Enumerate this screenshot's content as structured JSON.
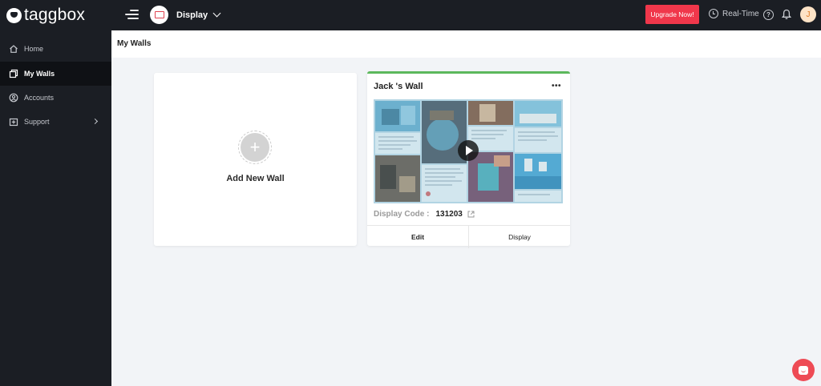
{
  "app": {
    "logo_text": "taggbox"
  },
  "topbar": {
    "display_label": "Display",
    "upgrade_label": "Upgrade Now!",
    "realtime_label": "Real-Time",
    "help_glyph": "?",
    "avatar_initial": "J",
    "accent_color": "#f0374b"
  },
  "sidebar": {
    "items": [
      {
        "label": "Home",
        "icon": "home-icon",
        "active": false
      },
      {
        "label": "My Walls",
        "icon": "walls-icon",
        "active": true
      },
      {
        "label": "Accounts",
        "icon": "accounts-icon",
        "active": false
      },
      {
        "label": "Support",
        "icon": "support-icon",
        "active": false,
        "has_submenu": true
      }
    ]
  },
  "page": {
    "title": "My Walls"
  },
  "add_card": {
    "plus_glyph": "+",
    "label": "Add New Wall"
  },
  "wall_card": {
    "title": "Jack 's Wall",
    "more_glyph": "•••",
    "display_code_label": "Display Code :",
    "display_code_value": "131203",
    "edit_label": "Edit",
    "display_label": "Display",
    "status_color": "#5cb85c"
  }
}
